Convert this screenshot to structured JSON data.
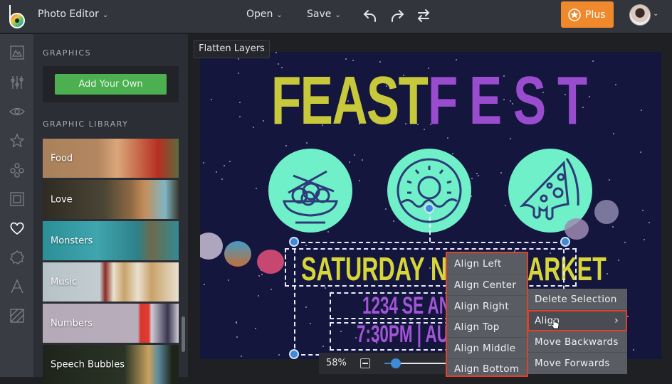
{
  "topbar": {
    "app_title": "Photo Editor",
    "menus": {
      "open": "Open",
      "save": "Save"
    },
    "icons": [
      "undo-icon",
      "redo-icon",
      "swap-icon"
    ],
    "plus_label": "Plus",
    "plus_color": "#f0892c"
  },
  "icon_rail": {
    "items": [
      "image-icon",
      "adjust-sliders-icon",
      "eye-icon",
      "star-icon",
      "graphics-circles-icon",
      "frame-icon",
      "heart-icon",
      "badge-icon",
      "text-icon",
      "texture-icon"
    ],
    "active": "heart-icon"
  },
  "panel": {
    "graphics_heading": "GRAPHICS",
    "add_your_own": "Add Your Own",
    "library_heading": "GRAPHIC LIBRARY",
    "library_items": [
      {
        "label": "Food"
      },
      {
        "label": "Love"
      },
      {
        "label": "Monsters"
      },
      {
        "label": "Music"
      },
      {
        "label": "Numbers"
      },
      {
        "label": "Speech Bubbles"
      }
    ]
  },
  "workspace": {
    "flatten_layers": "Flatten Layers",
    "zoom_level": "58%",
    "zoom_fraction": 0.1
  },
  "canvas": {
    "title_part1": "FEAST",
    "title_part2": "FEST",
    "line1": "SATURDAY NIGHT MARKET",
    "line2": "1234 SE ANKENY ST",
    "line3": "7:30PM | AUG 18",
    "colors": {
      "background": "#15163d",
      "yellow": "#c8c93a",
      "purple": "#9a4ccf",
      "mint": "#6ff0c8"
    }
  },
  "context_menu": {
    "items": [
      "Delete Selection",
      "Align",
      "Move Backwards",
      "Move Forwards"
    ],
    "active": "Align",
    "submenu": [
      "Align Left",
      "Align Center",
      "Align Right",
      "Align Top",
      "Align Middle",
      "Align Bottom"
    ]
  }
}
